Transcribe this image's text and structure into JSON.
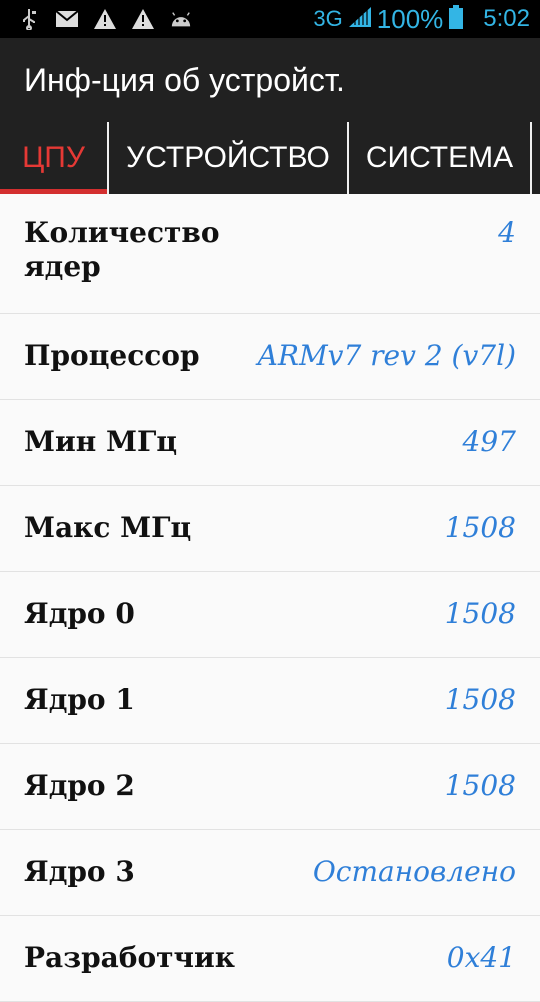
{
  "status_bar": {
    "icons": [
      "usb-icon",
      "mail-icon",
      "warning-icon",
      "warning-icon",
      "android-icon"
    ],
    "network": "3G",
    "battery": "100%",
    "time": "5:02",
    "accent": "#33b5e5"
  },
  "app": {
    "title": "Инф-ция об устройст."
  },
  "tabs": [
    {
      "label": "ЦПУ"
    },
    {
      "label": "УСТРОЙСТВО"
    },
    {
      "label": "СИСТЕМА"
    },
    {
      "label": ""
    }
  ],
  "rows": [
    {
      "label": "Количество ядер",
      "value": "4"
    },
    {
      "label": "Процессор",
      "value": "ARMv7  rev 2 (v7l)"
    },
    {
      "label": "Мин МГц",
      "value": "497"
    },
    {
      "label": "Макс МГц",
      "value": "1508"
    },
    {
      "label": "Ядро 0",
      "value": "1508"
    },
    {
      "label": "Ядро 1",
      "value": "1508"
    },
    {
      "label": "Ядро 2",
      "value": "1508"
    },
    {
      "label": "Ядро 3",
      "value": "Остановлено"
    },
    {
      "label": "Разработчик",
      "value": "0x41"
    }
  ],
  "colors": {
    "tab_active": "#e53935",
    "value_text": "#2f7fd8",
    "appbar": "#212121"
  }
}
